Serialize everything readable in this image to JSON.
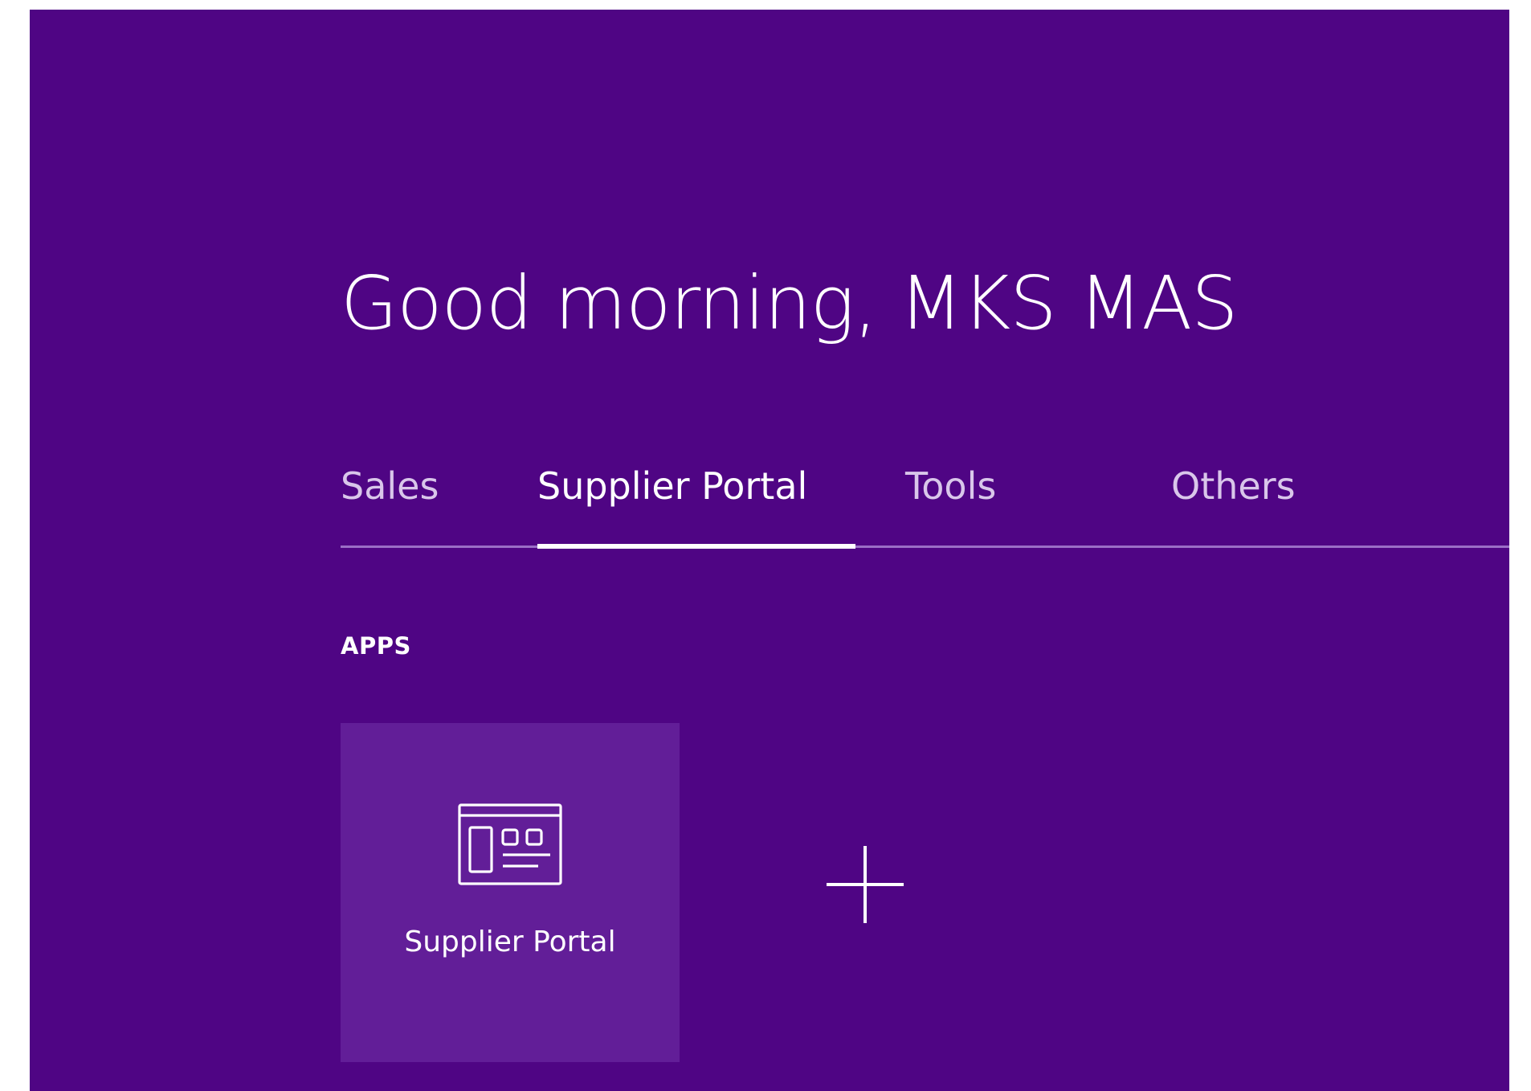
{
  "greeting": "Good morning, MKS MAS",
  "tabs": [
    {
      "label": "Sales",
      "active": false
    },
    {
      "label": "Supplier Portal",
      "active": true
    },
    {
      "label": "Tools",
      "active": false
    },
    {
      "label": "Others",
      "active": false
    }
  ],
  "section": {
    "label": "APPS"
  },
  "apps": [
    {
      "label": "Supplier Portal",
      "icon": "portal-window-icon"
    }
  ],
  "add_app": {
    "icon": "plus-icon"
  },
  "colors": {
    "background": "#4f0584",
    "tile": "#621e98",
    "tab_inactive": "#d9c6ea",
    "tab_track": "#9b6fc6",
    "text": "#ffffff"
  }
}
